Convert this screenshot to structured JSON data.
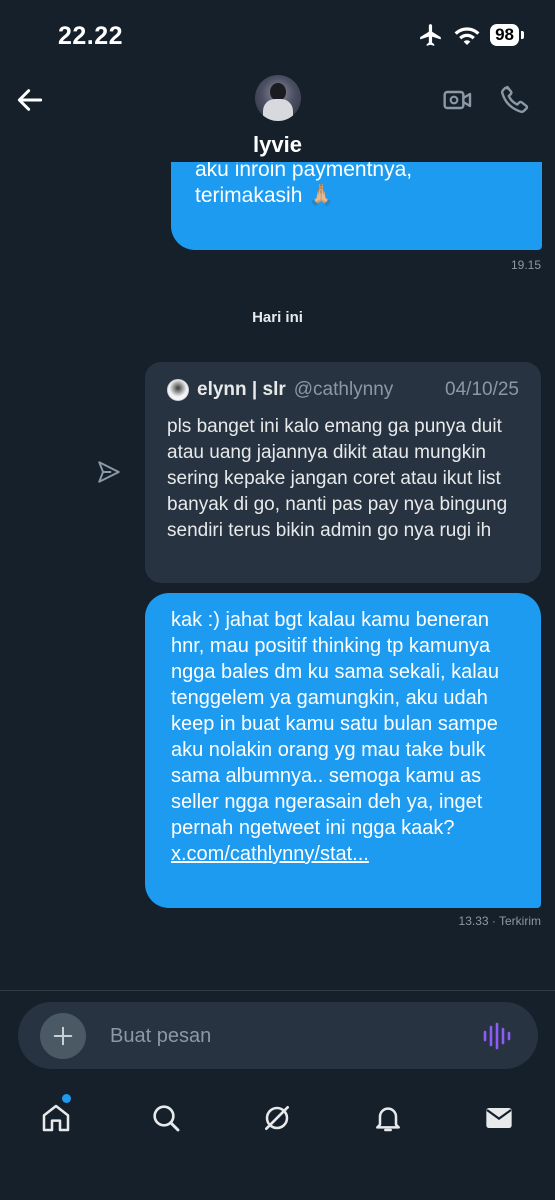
{
  "status_bar": {
    "time": "22.22",
    "battery": "98"
  },
  "header": {
    "contact_name": "lyvie"
  },
  "messages": {
    "previous": {
      "line1": "aku inroin paymentnya,",
      "line2": "terimakasih 🙏🏼",
      "time": "19.15"
    },
    "day_separator": "Hari ini",
    "quote": {
      "name": "elynn | slr",
      "handle": "@cathlynny",
      "date": "04/10/25",
      "text": "pls banget ini kalo emang ga punya duit atau uang jajannya dikit atau mungkin sering kepake jangan coret atau ikut list banyak di go, nanti pas pay nya bingung sendiri terus bikin admin go nya rugi ih"
    },
    "sent": {
      "text": "kak :) jahat bgt kalau kamu beneran hnr, mau positif thinking tp kamunya ngga bales dm ku sama sekali, kalau tenggelem ya gamungkin, aku udah keep in buat kamu satu bulan sampe aku nolakin orang yg mau take bulk sama albumnya.. semoga kamu as seller ngga ngerasain deh ya, inget pernah ngetweet ini ngga kaak?",
      "link": "x.com/cathlynny/stat...",
      "time_status": "13.33 · Terkirim"
    }
  },
  "composer": {
    "placeholder": "Buat pesan"
  },
  "colors": {
    "background": "#15202b",
    "accent": "#1d9bf0",
    "card": "#273340",
    "voice_icon": "#8c5cf6"
  },
  "icons": {
    "header": [
      "back-arrow-icon",
      "video-call-icon",
      "phone-icon"
    ],
    "tabs": [
      "home-icon",
      "search-icon",
      "grok-icon",
      "bell-icon",
      "mail-icon"
    ]
  }
}
